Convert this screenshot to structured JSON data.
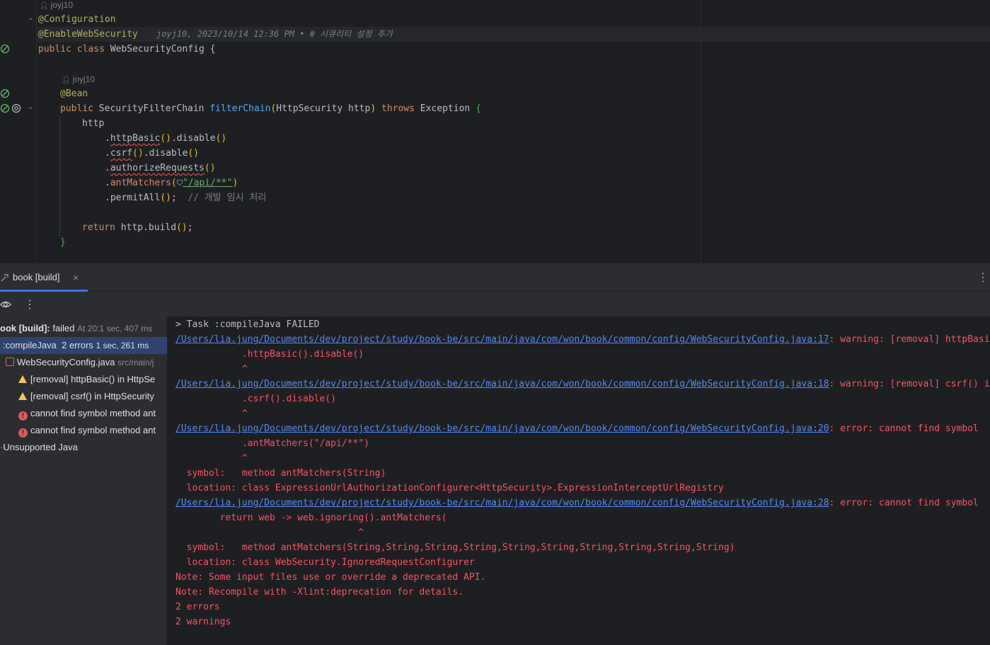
{
  "editor": {
    "author_top": "joyj10",
    "author_method": "joyj10",
    "lines": {
      "configuration": "@Configuration",
      "enable_web_security": "@EnableWebSecurity",
      "blame": "joyj10, 2023/10/14 12:36 PM • # 시큐리티 설정 추가",
      "class_kw_public": "public",
      "class_kw_class": "class",
      "class_name": "WebSecurityConfig",
      "brace_open": "{",
      "bean": "@Bean",
      "m_public": "public",
      "m_type": "SecurityFilterChain",
      "m_name": "filterChain",
      "m_params": "HttpSecurity http",
      "m_throws": "throws",
      "m_exception": "Exception",
      "http": "http",
      "http_basic_pre": ".",
      "http_basic": "httpBasic",
      "disable": ".disable",
      "csrf": "csrf",
      "authorize": "authorizeRequests",
      "ant_matchers": "antMatchers",
      "ant_arg": "\"/api/**\"",
      "permit_all": "permitAll",
      "comment": "// 개발 임시 처리",
      "return_kw": "return",
      "return_expr": "http.build",
      "brace_close": "}"
    }
  },
  "tool_window": {
    "tab_label": "book [build]",
    "tree": [
      {
        "label": "ook [build]:",
        "status": "failed",
        "sub": "At 20:1 sec, 407 ms"
      },
      {
        "label": ":compileJava",
        "status": "2 errors",
        "sub": "1 sec, 261 ms"
      },
      {
        "label": "WebSecurityConfig.java",
        "sub": "src/main/j"
      },
      {
        "label": "[removal] httpBasic() in HttpSe"
      },
      {
        "label": "[removal] csrf() in HttpSecurity"
      },
      {
        "label": "cannot find symbol method ant"
      },
      {
        "label": "cannot find symbol method ant"
      },
      {
        "label": "Unsupported Java"
      }
    ],
    "console": {
      "task": "> Task :compileJava FAILED",
      "path17": "/Users/lia.jung/Documents/dev/project/study/book-be/src/main/java/com/won/book/common/config/WebSecurityConfig.java:17",
      "msg17": ": warning: [removal] httpBasi",
      "code17": "            .httpBasic().disable()",
      "caret17": "            ^",
      "path18": "/Users/lia.jung/Documents/dev/project/study/book-be/src/main/java/com/won/book/common/config/WebSecurityConfig.java:18",
      "msg18": ": warning: [removal] csrf() i",
      "code18": "            .csrf().disable()",
      "caret18": "            ^",
      "path20": "/Users/lia.jung/Documents/dev/project/study/book-be/src/main/java/com/won/book/common/config/WebSecurityConfig.java:20",
      "msg20": ": error: cannot find symbol",
      "code20": "            .antMatchers(\"/api/**\")",
      "caret20": "            ^",
      "sym20": "  symbol:   method antMatchers(String)",
      "loc20": "  location: class ExpressionUrlAuthorizationConfigurer<HttpSecurity>.ExpressionInterceptUrlRegistry",
      "path28": "/Users/lia.jung/Documents/dev/project/study/book-be/src/main/java/com/won/book/common/config/WebSecurityConfig.java:28",
      "msg28": ": error: cannot find symbol",
      "code28": "        return web -> web.ignoring().antMatchers(",
      "caret28": "                                 ^",
      "sym28": "  symbol:   method antMatchers(String,String,String,String,String,String,String,String,String,String)",
      "loc28": "  location: class WebSecurity.IgnoredRequestConfigurer",
      "note1": "Note: Some input files use or override a deprecated API.",
      "note2": "Note: Recompile with -Xlint:deprecation for details.",
      "errors": "2 errors",
      "warnings": "2 warnings"
    }
  },
  "colors": {
    "accent": "#3574f0",
    "error": "#f75464",
    "link": "#548af7",
    "annotation": "#b3ae60",
    "keyword": "#cf8e6d"
  }
}
